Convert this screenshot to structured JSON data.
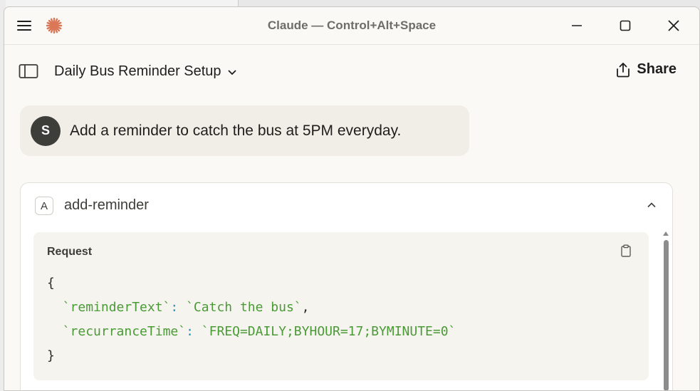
{
  "window": {
    "title": "Claude — Control+Alt+Space"
  },
  "header": {
    "chat_title": "Daily Bus Reminder Setup",
    "share_label": "Share"
  },
  "message": {
    "avatar_initial": "S",
    "text": "Add a reminder to catch the bus at 5PM everyday."
  },
  "tool": {
    "badge": "A",
    "name": "add-reminder",
    "panel_label": "Request",
    "code": {
      "open_brace": "{",
      "line1": {
        "key": "`reminderText`",
        "colon": ": ",
        "value": "`Catch the bus`",
        "trail": ","
      },
      "line2": {
        "key": "`recurranceTime`",
        "colon": ": ",
        "value": "`FREQ=DAILY;BYHOUR=17;BYMINUTE=0`",
        "trail": ""
      },
      "close_brace": "}"
    }
  },
  "colors": {
    "accent_logo": "#d97757",
    "code_string": "#4a9a36",
    "code_punct": "#2e8fb8"
  },
  "icons": [
    "menu-icon",
    "claude-logo-icon",
    "minimize-icon",
    "maximize-icon",
    "close-icon",
    "sidebar-toggle-icon",
    "chevron-down-icon",
    "share-icon",
    "chevron-up-icon",
    "clipboard-icon"
  ]
}
